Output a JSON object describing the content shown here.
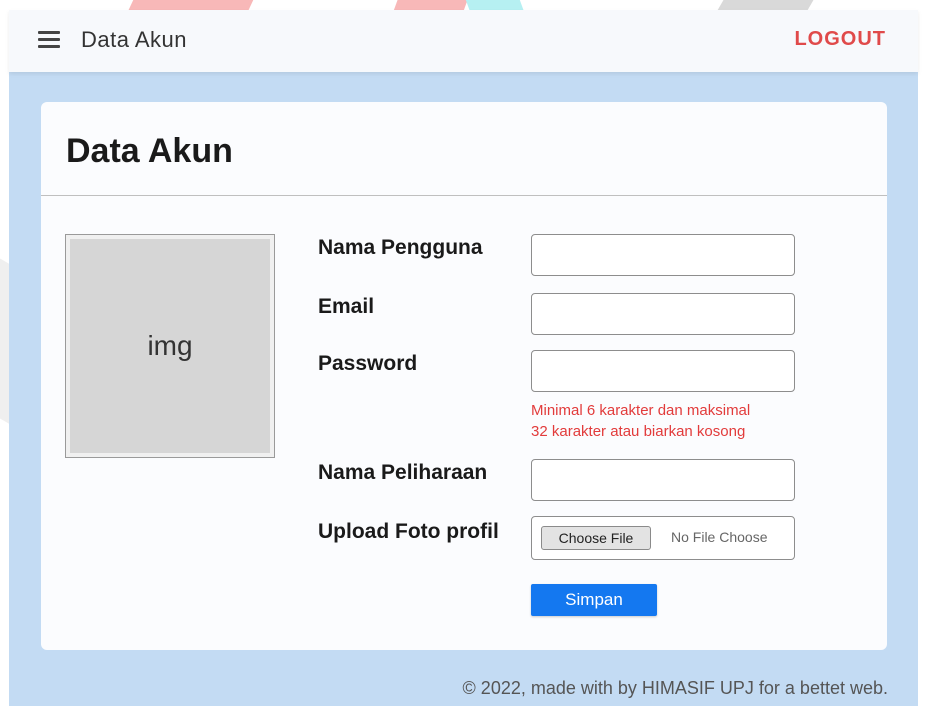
{
  "header": {
    "title": "Data Akun",
    "logout_label": "LOGOUT"
  },
  "card": {
    "title": "Data Akun",
    "avatar_placeholder": "img"
  },
  "form": {
    "username_label": "Nama Pengguna",
    "username_value": "",
    "email_label": "Email",
    "email_value": "",
    "password_label": "Password",
    "password_value": "",
    "password_hint_line1": "Minimal 6 karakter dan maksimal",
    "password_hint_line2": "32 karakter atau biarkan kosong",
    "pet_name_label": "Nama Peliharaan",
    "pet_name_value": "",
    "upload_label": "Upload Foto profil",
    "choose_file_label": "Choose File",
    "file_status": "No File Choose",
    "submit_label": "Simpan"
  },
  "footer": {
    "text": "© 2022, made with by HIMASIF UPJ for a bettet web."
  },
  "colors": {
    "accent": "#1478f0",
    "logout": "#e04a4a",
    "hint": "#e23b3b",
    "frame_background": "#c3dbf3"
  }
}
